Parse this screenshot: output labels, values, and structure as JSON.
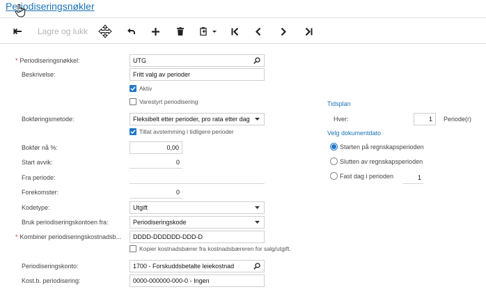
{
  "header": {
    "title": "Periodiseringsnøkler"
  },
  "toolbar": {
    "back_icon": "arrow-left-icon",
    "save_close_label": "Lagre og lukk",
    "move_cursor_icon": "move-cursor-icon",
    "undo_icon": "undo-icon",
    "add_icon": "plus-icon",
    "delete_icon": "trash-icon",
    "copy_paste_icon": "clipboard-icon",
    "first_icon": "first-record-icon",
    "prev_icon": "chevron-left-icon",
    "next_icon": "chevron-right-icon",
    "last_icon": "last-record-icon"
  },
  "form": {
    "key_label": "Periodiseringsnøkkel:",
    "key_value": "UTG",
    "description_label": "Beskrivelse:",
    "description_value": "Fritt valg av perioder",
    "active_label": "Aktiv",
    "active_checked": true,
    "item_driven_label": "Varestyrt periodisering",
    "item_driven_checked": false,
    "method_label": "Bokføringsmetode:",
    "method_value": "Fleksibelt etter perioder, pro rata etter dag",
    "allow_reconcile_label": "Tillat avstemming i tidligere perioder",
    "allow_reconcile_checked": true,
    "post_now_label": "Bokfør nå %:",
    "post_now_value": "0,00",
    "start_offset_label": "Start avvik:",
    "start_offset_value": "0",
    "from_period_label": "Fra periode:",
    "from_period_value": "",
    "occurrences_label": "Forekomster:",
    "occurrences_value": "0",
    "code_type_label": "Kodetype:",
    "code_type_value": "Utgift",
    "use_account_label": "Bruk periodiseringskontoen fra:",
    "use_account_value": "Periodiseringskode",
    "combine_sub_label": "Kombiner periodiseringskostnadsb...",
    "combine_sub_value": "DDDD-DDDDDD-DDD-D",
    "copy_sub_label": "Kopier kostnadsbærer fra kostnadsbæreren for salg/utgift.",
    "copy_sub_checked": false,
    "deferral_account_label": "Periodiseringskonto:",
    "deferral_account_value": "1700 - Forskuddsbetalte leiekostnad",
    "deferral_sub_label": "Kost.b. periodisering:",
    "deferral_sub_value": "0000-000000-000-0 - Ingen"
  },
  "schedule": {
    "title": "Tidsplan",
    "every_label": "Hver:",
    "every_value": "1",
    "period_unit": "Periode(r)",
    "doc_date_title": "Velg dokumentdato",
    "options": [
      {
        "label": "Starten på regnskapsperioden",
        "selected": true
      },
      {
        "label": "Slutten av regnskapsperioden",
        "selected": false
      },
      {
        "label": "Fast dag i perioden",
        "selected": false
      }
    ],
    "fixed_day_value": "1"
  },
  "colors": {
    "accent": "#1f78c8",
    "link": "#1a73b5",
    "required": "#c23a3a"
  }
}
